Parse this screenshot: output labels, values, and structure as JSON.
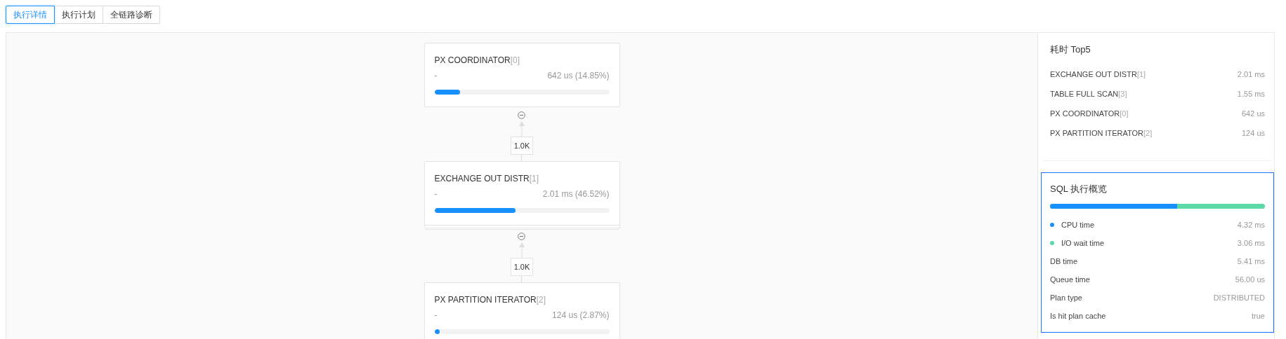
{
  "tabs": [
    {
      "label": "执行详情",
      "selected": true
    },
    {
      "label": "执行计划",
      "selected": false
    },
    {
      "label": "全链路诊断",
      "selected": false
    }
  ],
  "plan_nodes": [
    {
      "name": "PX COORDINATOR",
      "index": "[0]",
      "detail": "-",
      "time": "642 us (14.85%)",
      "level": 0.1485
    },
    {
      "name": "EXCHANGE OUT DISTR",
      "index": "[1]",
      "detail": "-",
      "time": "2.01 ms (46.52%)",
      "level": 0.4652,
      "stacked": true,
      "output_rows": "1.0K"
    },
    {
      "name": "PX PARTITION ITERATOR",
      "index": "[2]",
      "detail": "-",
      "time": "124 us (2.87%)",
      "level": 0.0287,
      "output_rows": "1.0K"
    }
  ],
  "top5": {
    "title": "耗时 Top5",
    "items": [
      {
        "name": "EXCHANGE OUT DISTR",
        "index": "[1]",
        "time": "2.01 ms"
      },
      {
        "name": "TABLE FULL SCAN",
        "index": "[3]",
        "time": "1.55 ms"
      },
      {
        "name": "PX COORDINATOR",
        "index": "[0]",
        "time": "642 us"
      },
      {
        "name": "PX PARTITION ITERATOR",
        "index": "[2]",
        "time": "124 us"
      }
    ]
  },
  "overview": {
    "title": "SQL 执行概览",
    "selected": true,
    "level": 0.59,
    "segments": [
      {
        "label": "CPU time",
        "value": "4.32 ms",
        "color": "#1890ff"
      },
      {
        "label": "I/O wait time",
        "value": "3.06 ms",
        "color": "#5cd9a6"
      }
    ],
    "rows": [
      {
        "label": "DB time",
        "value": "5.41 ms"
      },
      {
        "label": "Queue time",
        "value": "56.00 us"
      },
      {
        "label": "Plan type",
        "value": "DISTRIBUTED"
      },
      {
        "label": "Is hit plan cache",
        "value": "true"
      }
    ]
  }
}
